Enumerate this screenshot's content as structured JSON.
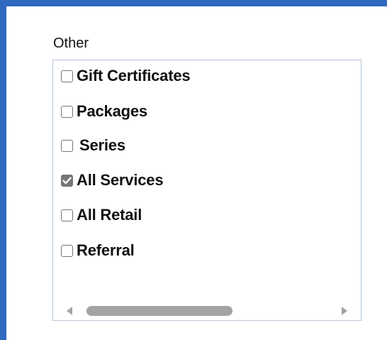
{
  "section": {
    "label": "Other"
  },
  "options": [
    {
      "label": "Gift Certificates",
      "checked": false
    },
    {
      "label": "Packages",
      "checked": false
    },
    {
      "label": "Series",
      "checked": false
    },
    {
      "label": "All Services",
      "checked": true
    },
    {
      "label": "All Retail",
      "checked": false
    },
    {
      "label": "Referral",
      "checked": false
    }
  ],
  "colors": {
    "frame": "#2e68c0",
    "checkbox": "#767676",
    "scrollbar": "#a3a3a3"
  },
  "icons": {
    "scroll_left": "triangle-left-icon",
    "scroll_right": "triangle-right-icon",
    "checkmark": "check-icon"
  }
}
